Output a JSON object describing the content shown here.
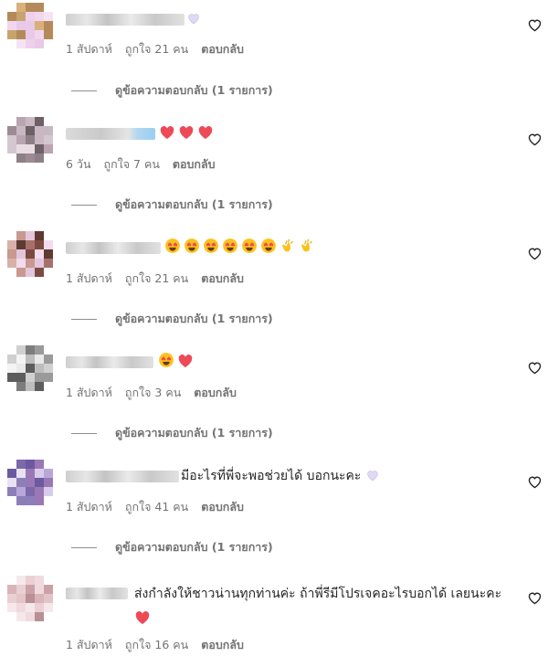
{
  "colors": {
    "text": "#262626",
    "muted": "#737373",
    "heart_red": "#ed4956",
    "emoji_yellow": "#fcc21b",
    "lilac_heart": "#d9d2f0"
  },
  "comments": [
    {
      "text": "",
      "emojis": [
        "white-heart"
      ],
      "time": "1 สัปดาห์",
      "likes": "ถูกใจ 21 คน",
      "reply_label": "ตอบกลับ",
      "view_replies": "ดูข้อความตอบกลับ (1 รายการ)"
    },
    {
      "text": "",
      "emojis": [
        "red-heart",
        "red-heart",
        "red-heart"
      ],
      "time": "6 วัน",
      "likes": "ถูกใจ 7 คน",
      "reply_label": "ตอบกลับ",
      "view_replies": "ดูข้อความตอบกลับ (1 รายการ)"
    },
    {
      "text": "",
      "emojis": [
        "heart-eyes",
        "heart-eyes",
        "heart-eyes",
        "heart-eyes",
        "heart-eyes",
        "heart-eyes",
        "clapping-hands",
        "clapping-hands"
      ],
      "time": "1 สัปดาห์",
      "likes": "ถูกใจ 21 คน",
      "reply_label": "ตอบกลับ",
      "view_replies": "ดูข้อความตอบกลับ (1 รายการ)"
    },
    {
      "text": "",
      "emojis": [
        "heart-eyes",
        "red-heart"
      ],
      "time": "1 สัปดาห์",
      "likes": "ถูกใจ 3 คน",
      "reply_label": "ตอบกลับ",
      "view_replies": "ดูข้อความตอบกลับ (1 รายการ)"
    },
    {
      "text": "มีอะไรที่พี่จะพอช่วยได้ บอกนะคะ",
      "emojis": [
        "white-heart"
      ],
      "time": "1 สัปดาห์",
      "likes": "ถูกใจ 41 คน",
      "reply_label": "ตอบกลับ",
      "view_replies": "ดูข้อความตอบกลับ (1 รายการ)"
    },
    {
      "text": "ส่งกำลังให้ชาวน่านทุกท่านค่ะ ถ้าพี่รีมีโปรเจคอะไรบอกได้ เลยนะคะ",
      "emojis": [
        "red-heart"
      ],
      "time": "1 สัปดาห์",
      "likes": "ถูกใจ 16 คน",
      "reply_label": "ตอบกลับ",
      "view_replies": ""
    }
  ]
}
